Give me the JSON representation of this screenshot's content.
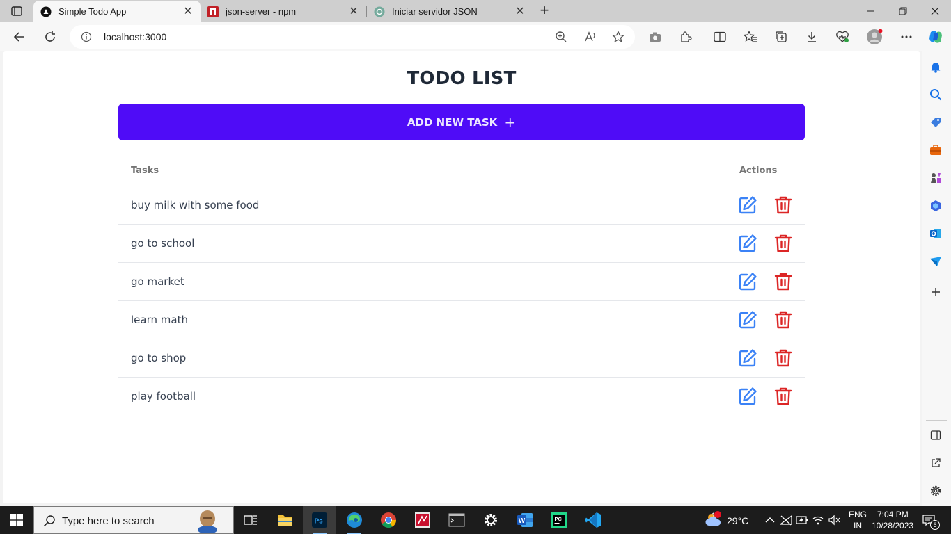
{
  "browser": {
    "tabs": [
      {
        "title": "Simple Todo App",
        "active": true
      },
      {
        "title": "json-server - npm",
        "active": false
      },
      {
        "title": "Iniciar servidor JSON",
        "active": false
      }
    ],
    "address": "localhost:3000"
  },
  "app": {
    "title": "TODO LIST",
    "add_button": "ADD NEW TASK",
    "add_icon": "+",
    "columns": {
      "tasks": "Tasks",
      "actions": "Actions"
    },
    "tasks": [
      "buy milk with some food",
      "go to school",
      "go market",
      "learn math",
      "go to shop",
      "play football"
    ],
    "colors": {
      "accent": "#4f0cf7",
      "edit": "#3b82f6",
      "delete": "#dc2626"
    }
  },
  "taskbar": {
    "search_placeholder": "Type here to search",
    "weather": "29°C",
    "lang": [
      "ENG",
      "IN"
    ],
    "time": "7:04 PM",
    "date": "10/28/2023",
    "notifications": "6",
    "weather_badge": "1"
  }
}
